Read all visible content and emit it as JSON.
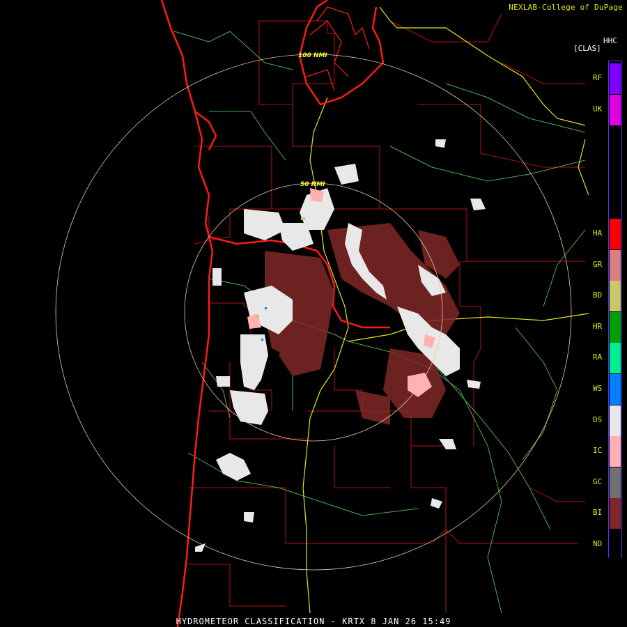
{
  "header": {
    "credit": "NEXLAB-College of DuPage",
    "product_code": "HHC",
    "mode": "[CLAS]"
  },
  "footer": {
    "caption": "HYDROMETEOR CLASSIFICATION - KRTX 8 JAN 26 15:49"
  },
  "range_rings": [
    {
      "label": "100 NMI"
    },
    {
      "label": "50 NMI"
    }
  ],
  "legend": [
    {
      "code": "RF",
      "color": "#8000ff"
    },
    {
      "code": "UK",
      "color": "#e000e0"
    },
    {
      "code": "HA",
      "color": "#ff0000"
    },
    {
      "code": "GR",
      "color": "#d98080"
    },
    {
      "code": "BD",
      "color": "#c8c864"
    },
    {
      "code": "HR",
      "color": "#00a000"
    },
    {
      "code": "RA",
      "color": "#00ee90"
    },
    {
      "code": "WS",
      "color": "#0080ff"
    },
    {
      "code": "DS",
      "color": "#e8e8e8"
    },
    {
      "code": "IC",
      "color": "#ffb0b0"
    },
    {
      "code": "GC",
      "color": "#707070"
    },
    {
      "code": "BI",
      "color": "#802828"
    },
    {
      "code": "ND",
      "color": "#000000"
    }
  ]
}
